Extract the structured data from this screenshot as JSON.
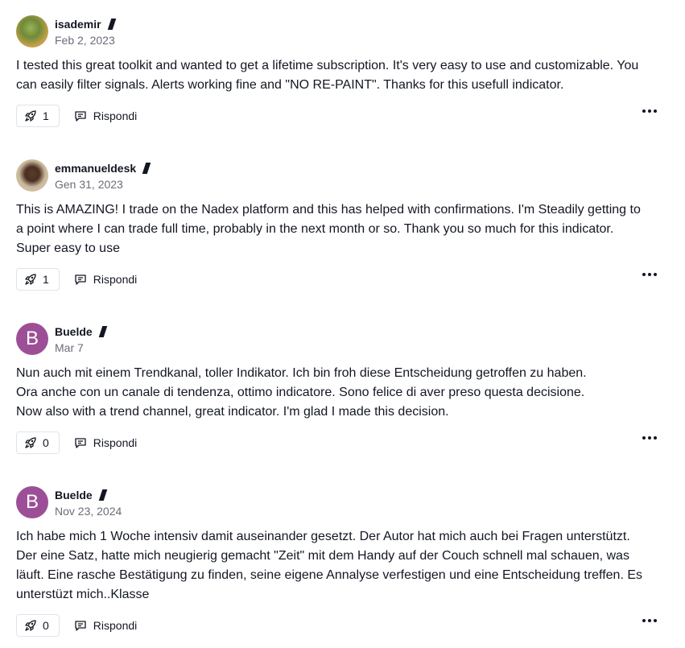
{
  "comments": [
    {
      "author": "isademir",
      "date": "Feb 2, 2023",
      "avatar": "photo-plant",
      "text": "I tested this great toolkit and wanted to get a lifetime subscription. It's very easy to use and customizable. You\ncan easily filter signals. Alerts working fine and \"NO RE-PAINT\". Thanks for this usefull indicator.",
      "boosts": "1",
      "reply_label": "Rispondi"
    },
    {
      "author": "emmanueldesk",
      "date": "Gen 31, 2023",
      "avatar": "photo-person",
      "text": "This is AMAZING! I trade on the Nadex platform and this has helped with confirmations. I'm Steadily getting to\na point where I can trade full time, probably in the next month or so. Thank you so much for this indicator.\nSuper easy to use",
      "boosts": "1",
      "reply_label": "Rispondi"
    },
    {
      "author": "Buelde",
      "date": "Mar 7",
      "avatar_letter": "B",
      "text": "Nun auch mit einem Trendkanal, toller Indikator. Ich bin froh diese Entscheidung getroffen zu haben.\nOra anche con un canale di tendenza, ottimo indicatore. Sono felice di aver preso questa decisione.\nNow also with a trend channel, great indicator. I'm glad I made this decision.",
      "boosts": "0",
      "reply_label": "Rispondi"
    },
    {
      "author": "Buelde",
      "date": "Nov 23, 2024",
      "avatar_letter": "B",
      "text": "Ich habe mich 1 Woche intensiv damit auseinander gesetzt. Der Autor hat mich auch bei Fragen unterstützt.\nDer eine Satz, hatte mich neugierig gemacht \"Zeit\" mit dem Handy auf der Couch schnell mal schauen, was\nläuft. Eine rasche Bestätigung zu finden, seine eigene Annalyse verfestigen und eine Entscheidung treffen. Es\nunterstüzt mich..Klasse",
      "boosts": "0",
      "reply_label": "Rispondi"
    }
  ],
  "colors": {
    "text": "#131722",
    "muted": "#6a6d78",
    "border": "#e0e3eb",
    "letter_avatar": "#9c4f96"
  }
}
